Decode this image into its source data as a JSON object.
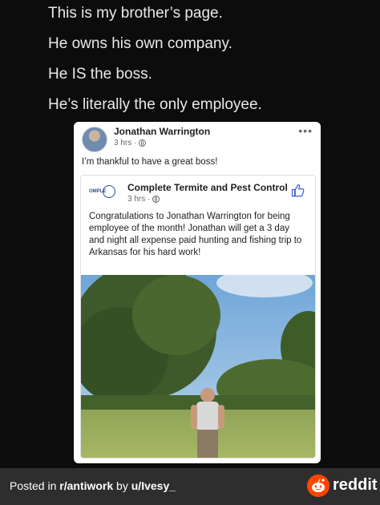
{
  "caption": {
    "lines": [
      "This is my brother’s page.",
      "He owns his own company.",
      "He IS the boss.",
      "He’s literally the only employee."
    ]
  },
  "post": {
    "author": "Jonathan Warrington",
    "time": "3 hrs ·",
    "text": "I’m thankful to have a great boss!",
    "more_icon": "ellipsis-icon",
    "shared": {
      "company": "Complete Termite and Pest Control",
      "time": "3 hrs ·",
      "logo_text": "OMPLE",
      "body": "Congratulations to Jonathan Warrington for being employee of the month! Jonathan will get a 3 day and night all expense paid hunting and fishing trip to Arkansas for his hard work!",
      "like_icon": "thumbs-up-icon"
    }
  },
  "footer": {
    "posted_prefix": "Posted in ",
    "subreddit": "r/antiwork",
    "by": " by ",
    "user": "u/Ivesy_",
    "brand": "reddit"
  },
  "colors": {
    "background": "#0c0c0c",
    "footer_bg": "#2e2e2e",
    "reddit_orange": "#ff4500",
    "facebook_meta": "#65676b"
  }
}
